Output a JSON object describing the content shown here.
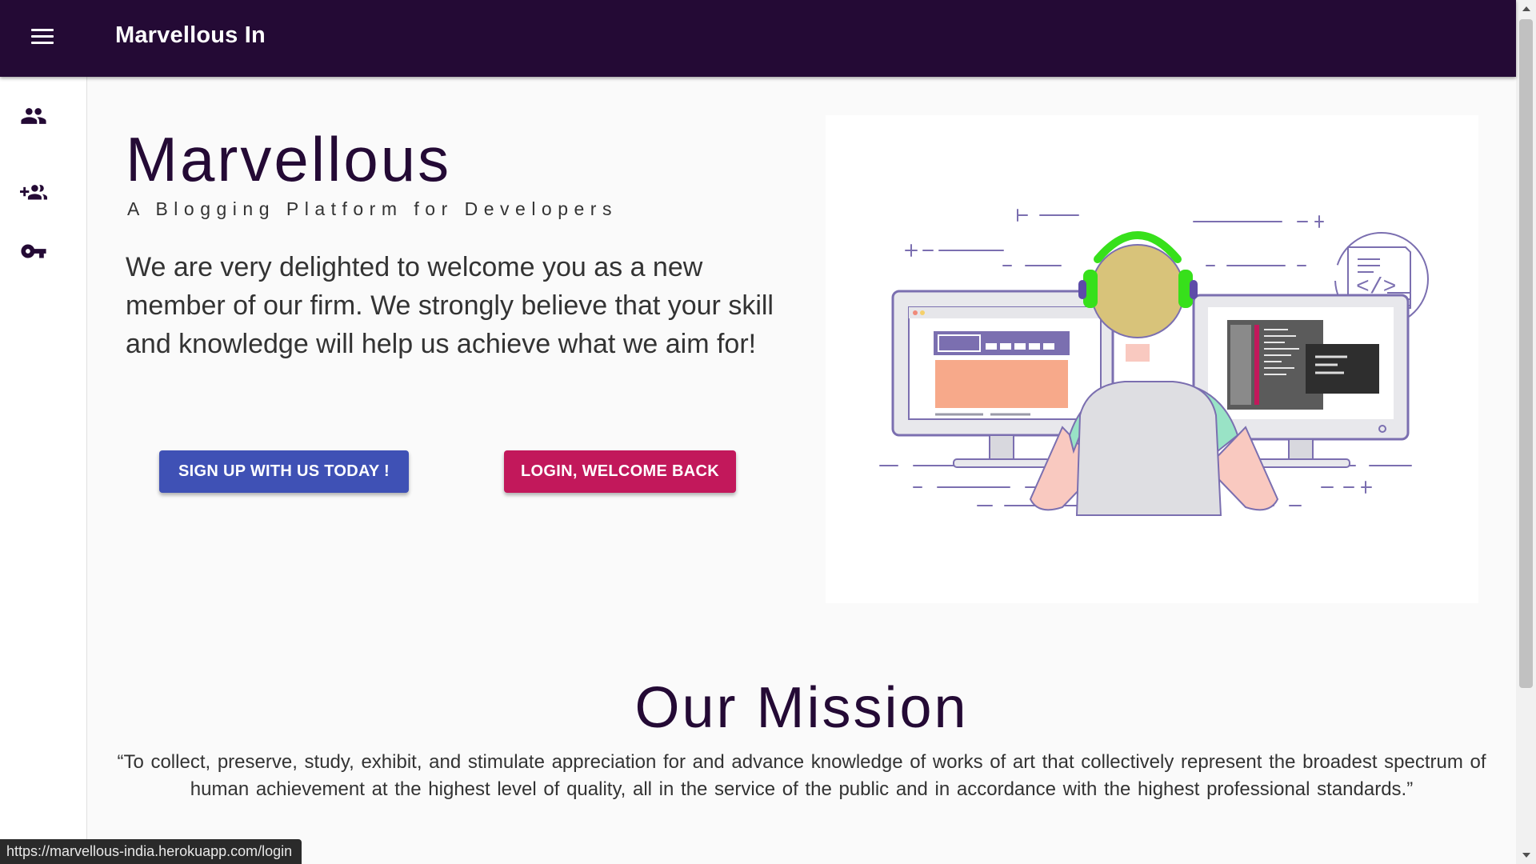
{
  "app": {
    "brand": "Marvellous In"
  },
  "sidenav": {
    "items": [
      {
        "icon": "people-icon"
      },
      {
        "icon": "group-add-icon"
      },
      {
        "icon": "vpn-key-icon"
      }
    ]
  },
  "hero": {
    "title": "Marvellous",
    "subtitle": "A Blogging Platform for Developers",
    "text": "We are very delighted to welcome you as a new member of our firm. We strongly believe that your skill and knowledge will help us achieve what we aim for!",
    "signup_label": "SIGN UP WITH US TODAY !",
    "login_label": "LOGIN, WELCOME BACK"
  },
  "mission": {
    "title": "Our Mission",
    "text": "“To collect, preserve, study, exhibit, and stimulate appreciation for and advance knowledge of works of art that collectively represent the broadest spectrum of human achievement at the highest level of quality, all in the service of the public and in accordance with the highest professional standards.”"
  },
  "status_bar": {
    "url": "https://marvellous-india.herokuapp.com/login"
  },
  "colors": {
    "appbar": "#240a35",
    "signup_button": "#3f51b5",
    "login_button": "#c2185b",
    "heading": "#240a35"
  }
}
